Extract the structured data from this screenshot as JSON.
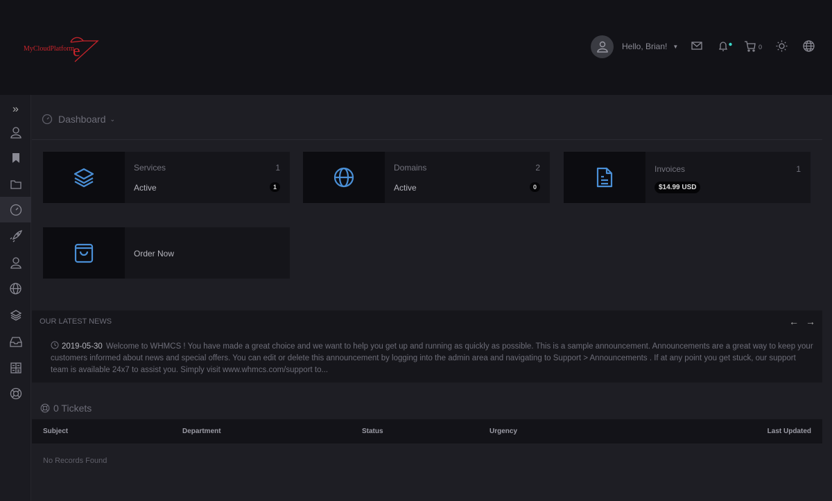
{
  "header": {
    "logo_text": "MyCloudPlatform",
    "greeting": "Hello, Brian!",
    "cart_count": "0"
  },
  "breadcrumb": {
    "title": "Dashboard"
  },
  "cards": [
    {
      "title": "Services",
      "count": "1",
      "sub": "Active",
      "badge": "1"
    },
    {
      "title": "Domains",
      "count": "2",
      "sub": "Active",
      "badge": "0"
    },
    {
      "title": "Invoices",
      "count": "1",
      "amount": "$14.99 USD"
    },
    {
      "title": "Order Now"
    }
  ],
  "news": {
    "title": "OUR LATEST NEWS",
    "date": "2019-05-30",
    "text": "Welcome to WHMCS ! You have made a great choice and we want to help you get up and running as quickly as possible. This is a sample announcement. Announcements are a great way to keep your customers informed about news and special offers. You can edit or delete this announcement by logging into the admin area and navigating to Support > Announcements . If at any point you get stuck, our support team is available 24x7 to assist you. Simply visit www.whmcs.com/support to..."
  },
  "tickets": {
    "title": "0 Tickets",
    "columns": [
      "Subject",
      "Department",
      "Status",
      "Urgency",
      "Last Updated"
    ],
    "empty": "No Records Found"
  },
  "colors": {
    "accent": "#4a8fd6",
    "brand": "#c8242b",
    "notify": "#3ad6c8"
  }
}
